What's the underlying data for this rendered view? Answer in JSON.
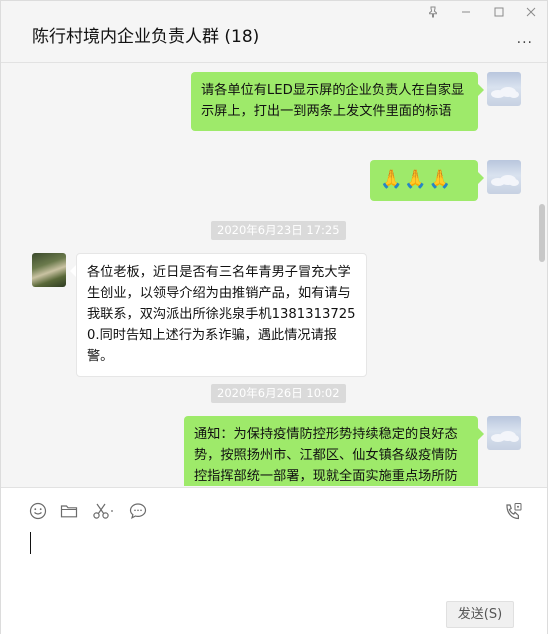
{
  "window": {
    "title": "陈行村境内企业负责人群 (18)",
    "pin_icon": "pin-icon",
    "minimize_icon": "minimize-icon",
    "maximize_icon": "maximize-icon",
    "close_icon": "close-icon",
    "more_label": "..."
  },
  "messages": [
    {
      "sender": "me",
      "text": "请各单位有LED显示屏的企业负责人在自家显示屏上，打出一到两条上发文件里面的标语"
    },
    {
      "sender": "me",
      "text": "🙏🙏🙏"
    },
    {
      "timestamp": "2020年6月23日 17:25"
    },
    {
      "sender": "other",
      "text": "各位老板，近日是否有三名年青男子冒充大学生创业，以领导介绍为由推销产品，如有请与我联系，双沟派出所徐兆泉手机13813137250.同时告知上述行为系诈骗，遇此情况请报警。"
    },
    {
      "timestamp": "2020年6月26日 10:02"
    },
    {
      "sender": "me",
      "text": "通知：为保持疫情防控形势持续稳定的良好态势，按照扬州市、江都区、仙女镇各级疫情防控指挥部统一部署，现就全面实施重点场所防控常态化措施有关事项通知如下：请"
    }
  ],
  "toolbar": {
    "emoji_icon": "emoji-icon",
    "folder_icon": "folder-icon",
    "scissors_icon": "scissors-icon",
    "chat_icon": "chat-bubble-icon",
    "phone_icon": "phone-icon"
  },
  "input": {
    "value": ""
  },
  "send_label": "发送(S)",
  "colors": {
    "my_bubble": "#9eea6a",
    "other_bubble": "#ffffff",
    "background": "#f5f5f5",
    "timestamp_bg": "#dadada"
  }
}
